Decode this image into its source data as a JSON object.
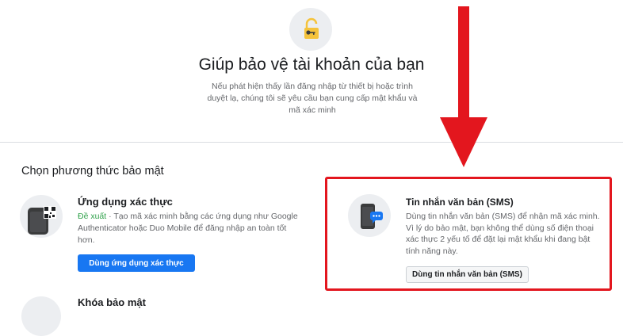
{
  "header": {
    "icon": "lock-key-icon",
    "title": "Giúp bảo vệ tài khoản của bạn",
    "description": "Nếu phát hiện thấy lần đăng nhập từ thiết bị hoặc trình duyệt lạ, chúng tôi sẽ yêu cầu bạn cung cấp mật khẩu và mã xác minh"
  },
  "security": {
    "section_title": "Chọn phương thức bảo mật",
    "options": [
      {
        "icon": "qr-code-phone-icon",
        "title": "Ứng dụng xác thực",
        "recommended_label": "Đề xuất",
        "description": " · Tạo mã xác minh bằng các ứng dụng như Google Authenticator hoặc Duo Mobile để đăng nhập an toàn tốt hơn.",
        "button_label": "Dùng ứng dụng xác thực"
      },
      {
        "icon": "sms-phone-icon",
        "title": "Tin nhắn văn bản (SMS)",
        "description": "Dùng tin nhắn văn bản (SMS) để nhận mã xác minh. Vì lý do bảo mật, bạn không thể dùng số điện thoại xác thực 2 yếu tố để đặt lại mật khẩu khi đang bật tính năng này.",
        "button_label": "Dùng tin nhắn văn bản (SMS)"
      },
      {
        "title": "Khóa bảo mật"
      }
    ]
  },
  "annotation": {
    "highlight_color": "#e3161e",
    "arrow_color": "#e3161e"
  },
  "colors": {
    "primary": "#1877f2",
    "recommended": "#31a24c",
    "muted_text": "#65676b"
  }
}
